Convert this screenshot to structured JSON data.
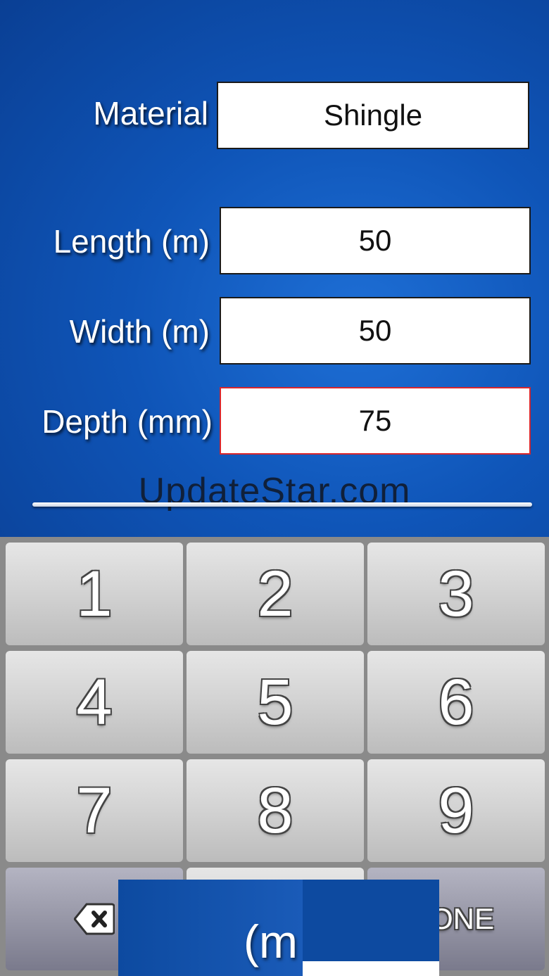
{
  "form": {
    "material": {
      "label": "Material",
      "value": "Shingle"
    },
    "length": {
      "label": "Length (m)",
      "value": "50"
    },
    "width": {
      "label": "Width (m)",
      "value": "50"
    },
    "depth": {
      "label": "Depth (mm)",
      "value": "75"
    }
  },
  "watermark": "UpdateStar.com",
  "keypad": {
    "keys": [
      "1",
      "2",
      "3",
      "4",
      "5",
      "6",
      "7",
      "8",
      "9"
    ],
    "done_label": "ONE",
    "delete_icon": "backspace-icon"
  },
  "overlay": {
    "fragment_text": "(m"
  },
  "colors": {
    "background": "#0f55b8",
    "active_border": "#d8262c",
    "keypad_bg": "#8a8a8a"
  }
}
